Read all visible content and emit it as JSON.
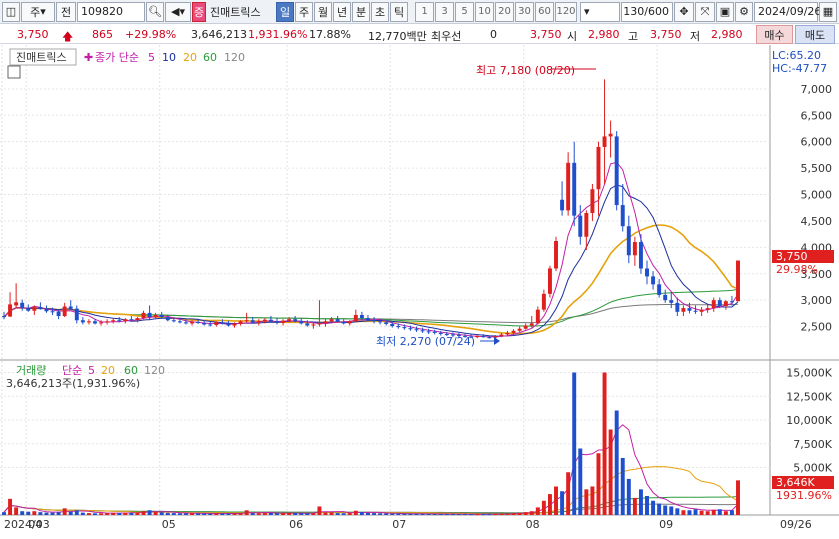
{
  "toolbar": {
    "type_label": "주",
    "prev_label": "전",
    "code": "109820",
    "stock_tag": "증",
    "stock_name": "진매트릭스",
    "periods": [
      "일",
      "주",
      "월",
      "년",
      "분",
      "초",
      "틱"
    ],
    "selected_period": "일",
    "intervals": [
      "1",
      "3",
      "5",
      "10",
      "20",
      "30",
      "60",
      "120"
    ],
    "count": "130/600",
    "date": "2024/09/26"
  },
  "quote": {
    "price": "3,750",
    "change": "865",
    "change_pct": "+29.98%",
    "volume": "3,646,213",
    "volume_pct": "1,931.96%",
    "turnover": "17.88%",
    "amount": "12,770백만",
    "priority_label": "최우선",
    "priority_value": "0",
    "ask": "3,750",
    "open_label": "시",
    "open": "2,980",
    "high_label": "고",
    "high": "3,750",
    "low_label": "저",
    "low": "2,980",
    "buy": "매수",
    "sell": "매도"
  },
  "price_legend": {
    "name": "진매트릭스",
    "ma_label": "종가 단순",
    "ma_periods": [
      "5",
      "10",
      "20",
      "60",
      "120"
    ]
  },
  "volume_legend": {
    "name": "거래량",
    "ma_label": "단순",
    "ma_periods": [
      "5",
      "20",
      "60",
      "120"
    ],
    "summary": "3,646,213주(1,931.96%)"
  },
  "annotations": {
    "high": "최고 7,180 (08/20)",
    "low": "최저 2,270 (07/24)",
    "lc": "LC:65.20",
    "hc": "HC:-47.77"
  },
  "price_axis": {
    "ticks": [
      "7,000",
      "6,500",
      "6,000",
      "5,500",
      "5,000",
      "4,500",
      "4,000",
      "3,500",
      "3,000",
      "2,500"
    ],
    "current": "3,750",
    "current_pct": "29.98%"
  },
  "volume_axis": {
    "ticks": [
      "15,000K",
      "12,500K",
      "10,000K",
      "7,500K",
      "5,000K"
    ],
    "current": "3,646K",
    "current_pct": "1931.96%"
  },
  "x_axis": {
    "labels": [
      "2024/03",
      "04",
      "05",
      "06",
      "07",
      "08",
      "09",
      "09/26"
    ]
  },
  "colors": {
    "up": "#e0201e",
    "down": "#1f4fcc",
    "ma5": "#c21fa8",
    "ma10": "#1c2f9e",
    "ma20": "#e6a20c",
    "ma60": "#2a9a3a",
    "ma120": "#7a7a7a"
  },
  "chart_data": {
    "type": "candlestick",
    "x": [
      "03/26",
      "03/27",
      "03/28",
      "03/29",
      "04/01",
      "04/02",
      "04/03",
      "04/04",
      "04/05",
      "04/08",
      "04/09",
      "04/11",
      "04/12",
      "04/15",
      "04/16",
      "04/17",
      "04/18",
      "04/19",
      "04/22",
      "04/23",
      "04/24",
      "04/25",
      "04/26",
      "04/29",
      "04/30",
      "05/02",
      "05/03",
      "05/07",
      "05/08",
      "05/09",
      "05/10",
      "05/13",
      "05/14",
      "05/16",
      "05/17",
      "05/20",
      "05/21",
      "05/22",
      "05/23",
      "05/24",
      "05/27",
      "05/28",
      "05/29",
      "05/30",
      "05/31",
      "06/03",
      "06/04",
      "06/05",
      "06/07",
      "06/10",
      "06/11",
      "06/12",
      "06/13",
      "06/14",
      "06/17",
      "06/18",
      "06/19",
      "06/20",
      "06/21",
      "06/24",
      "06/25",
      "06/26",
      "06/27",
      "06/28",
      "07/01",
      "07/02",
      "07/03",
      "07/04",
      "07/05",
      "07/08",
      "07/09",
      "07/10",
      "07/11",
      "07/12",
      "07/15",
      "07/16",
      "07/17",
      "07/18",
      "07/19",
      "07/22",
      "07/23",
      "07/24",
      "07/25",
      "07/26",
      "07/29",
      "07/30",
      "07/31",
      "08/01",
      "08/02",
      "08/05",
      "08/06",
      "08/07",
      "08/08",
      "08/09",
      "08/12",
      "08/13",
      "08/14",
      "08/16",
      "08/19",
      "08/20",
      "08/21",
      "08/22",
      "08/23",
      "08/26",
      "08/27",
      "08/28",
      "08/29",
      "08/30",
      "09/02",
      "09/03",
      "09/04",
      "09/05",
      "09/06",
      "09/09",
      "09/10",
      "09/11",
      "09/12",
      "09/13",
      "09/19",
      "09/20",
      "09/23",
      "09/24",
      "09/25",
      "09/26"
    ],
    "ohlc": [
      [
        2700,
        2780,
        2640,
        2680
      ],
      [
        2690,
        3150,
        2680,
        2920
      ],
      [
        2900,
        3320,
        2850,
        2960
      ],
      [
        2950,
        3010,
        2800,
        2860
      ],
      [
        2860,
        2920,
        2780,
        2800
      ],
      [
        2800,
        2900,
        2720,
        2870
      ],
      [
        2870,
        2960,
        2820,
        2830
      ],
      [
        2830,
        2900,
        2760,
        2790
      ],
      [
        2790,
        2860,
        2720,
        2780
      ],
      [
        2780,
        2820,
        2640,
        2700
      ],
      [
        2700,
        2950,
        2680,
        2880
      ],
      [
        2880,
        3000,
        2820,
        2840
      ],
      [
        2840,
        2900,
        2560,
        2620
      ],
      [
        2620,
        2680,
        2540,
        2580
      ],
      [
        2580,
        2640,
        2540,
        2600
      ],
      [
        2600,
        2640,
        2540,
        2560
      ],
      [
        2560,
        2620,
        2520,
        2580
      ],
      [
        2580,
        2640,
        2540,
        2600
      ],
      [
        2600,
        2660,
        2560,
        2620
      ],
      [
        2620,
        2680,
        2580,
        2600
      ],
      [
        2600,
        2660,
        2560,
        2640
      ],
      [
        2640,
        2700,
        2600,
        2620
      ],
      [
        2620,
        2680,
        2580,
        2660
      ],
      [
        2660,
        2800,
        2640,
        2760
      ],
      [
        2760,
        2900,
        2620,
        2680
      ],
      [
        2680,
        2760,
        2640,
        2720
      ],
      [
        2720,
        2780,
        2660,
        2680
      ],
      [
        2680,
        2720,
        2600,
        2620
      ],
      [
        2620,
        2680,
        2580,
        2600
      ],
      [
        2600,
        2660,
        2560,
        2580
      ],
      [
        2580,
        2640,
        2540,
        2560
      ],
      [
        2560,
        2620,
        2520,
        2590
      ],
      [
        2590,
        2650,
        2550,
        2570
      ],
      [
        2570,
        2620,
        2520,
        2540
      ],
      [
        2540,
        2600,
        2500,
        2530
      ],
      [
        2530,
        2600,
        2500,
        2580
      ],
      [
        2580,
        2640,
        2540,
        2560
      ],
      [
        2560,
        2610,
        2500,
        2520
      ],
      [
        2520,
        2580,
        2480,
        2550
      ],
      [
        2550,
        2620,
        2520,
        2600
      ],
      [
        2600,
        2760,
        2580,
        2620
      ],
      [
        2620,
        2680,
        2560,
        2580
      ],
      [
        2580,
        2640,
        2520,
        2600
      ],
      [
        2600,
        2660,
        2560,
        2630
      ],
      [
        2630,
        2700,
        2580,
        2600
      ],
      [
        2600,
        2660,
        2540,
        2570
      ],
      [
        2570,
        2640,
        2520,
        2610
      ],
      [
        2610,
        2680,
        2580,
        2640
      ],
      [
        2640,
        2700,
        2580,
        2600
      ],
      [
        2600,
        2660,
        2540,
        2560
      ],
      [
        2560,
        2620,
        2500,
        2520
      ],
      [
        2520,
        2580,
        2460,
        2540
      ],
      [
        2540,
        3000,
        2500,
        2560
      ],
      [
        2560,
        2640,
        2500,
        2600
      ],
      [
        2600,
        2680,
        2560,
        2640
      ],
      [
        2640,
        2700,
        2580,
        2590
      ],
      [
        2590,
        2640,
        2540,
        2560
      ],
      [
        2560,
        2620,
        2520,
        2600
      ],
      [
        2600,
        2820,
        2580,
        2720
      ],
      [
        2720,
        2780,
        2620,
        2660
      ],
      [
        2660,
        2720,
        2600,
        2620
      ],
      [
        2620,
        2680,
        2560,
        2600
      ],
      [
        2600,
        2640,
        2540,
        2580
      ],
      [
        2580,
        2620,
        2520,
        2550
      ],
      [
        2550,
        2600,
        2480,
        2510
      ],
      [
        2510,
        2560,
        2460,
        2490
      ],
      [
        2490,
        2540,
        2440,
        2470
      ],
      [
        2470,
        2520,
        2420,
        2450
      ],
      [
        2450,
        2500,
        2400,
        2430
      ],
      [
        2430,
        2480,
        2380,
        2410
      ],
      [
        2410,
        2460,
        2360,
        2400
      ],
      [
        2400,
        2440,
        2350,
        2380
      ],
      [
        2380,
        2420,
        2330,
        2360
      ],
      [
        2360,
        2400,
        2320,
        2350
      ],
      [
        2350,
        2390,
        2300,
        2340
      ],
      [
        2340,
        2380,
        2300,
        2320
      ],
      [
        2320,
        2360,
        2290,
        2310
      ],
      [
        2310,
        2350,
        2280,
        2300
      ],
      [
        2300,
        2340,
        2280,
        2320
      ],
      [
        2320,
        2360,
        2290,
        2300
      ],
      [
        2300,
        2330,
        2270,
        2290
      ],
      [
        2290,
        2340,
        2270,
        2320
      ],
      [
        2320,
        2380,
        2300,
        2350
      ],
      [
        2350,
        2420,
        2330,
        2380
      ],
      [
        2380,
        2450,
        2350,
        2420
      ],
      [
        2420,
        2500,
        2400,
        2460
      ],
      [
        2460,
        2560,
        2440,
        2520
      ],
      [
        2520,
        2700,
        2480,
        2560
      ],
      [
        2560,
        2880,
        2540,
        2820
      ],
      [
        2820,
        3200,
        2780,
        3120
      ],
      [
        3120,
        3650,
        3050,
        3600
      ],
      [
        3600,
        4200,
        3550,
        4120
      ],
      [
        4900,
        5250,
        4600,
        4700
      ],
      [
        4700,
        5800,
        4600,
        5600
      ],
      [
        5600,
        6000,
        4400,
        4600
      ],
      [
        4600,
        4800,
        4050,
        4200
      ],
      [
        4200,
        4700,
        3950,
        4650
      ],
      [
        4650,
        5200,
        4500,
        5100
      ],
      [
        5100,
        6000,
        4600,
        5900
      ],
      [
        5900,
        7180,
        5200,
        6100
      ],
      [
        6100,
        6400,
        5700,
        6150
      ],
      [
        6100,
        6200,
        4700,
        4800
      ],
      [
        4800,
        5200,
        4300,
        4400
      ],
      [
        4400,
        4600,
        3700,
        3850
      ],
      [
        3850,
        4200,
        3650,
        4100
      ],
      [
        4100,
        4250,
        3500,
        3600
      ],
      [
        3600,
        3750,
        3300,
        3450
      ],
      [
        3450,
        3550,
        3200,
        3300
      ],
      [
        3300,
        3400,
        3050,
        3100
      ],
      [
        3100,
        3200,
        2950,
        3000
      ],
      [
        3000,
        3150,
        2850,
        2950
      ],
      [
        2950,
        3050,
        2700,
        2780
      ],
      [
        2780,
        2900,
        2700,
        2850
      ],
      [
        2850,
        2950,
        2750,
        2800
      ],
      [
        2800,
        2900,
        2740,
        2780
      ],
      [
        2780,
        2870,
        2700,
        2820
      ],
      [
        2820,
        2920,
        2760,
        2850
      ],
      [
        2850,
        3050,
        2780,
        3000
      ],
      [
        3000,
        3050,
        2850,
        2890
      ],
      [
        2890,
        3000,
        2820,
        2980
      ],
      [
        2980,
        3080,
        2900,
        2960
      ],
      [
        2980,
        3750,
        2980,
        3750
      ]
    ],
    "volume_k": [
      300,
      1700,
      800,
      400,
      350,
      400,
      300,
      250,
      250,
      300,
      700,
      350,
      500,
      250,
      200,
      180,
      180,
      200,
      220,
      200,
      250,
      220,
      260,
      400,
      500,
      300,
      280,
      220,
      200,
      180,
      170,
      170,
      160,
      150,
      140,
      170,
      160,
      150,
      150,
      170,
      500,
      200,
      180,
      200,
      220,
      180,
      200,
      220,
      200,
      180,
      170,
      160,
      900,
      250,
      260,
      200,
      180,
      200,
      450,
      300,
      220,
      200,
      180,
      160,
      150,
      140,
      130,
      120,
      120,
      110,
      110,
      100,
      100,
      100,
      100,
      100,
      100,
      90,
      90,
      90,
      90,
      100,
      120,
      150,
      180,
      220,
      300,
      400,
      800,
      1500,
      2200,
      3000,
      2500,
      4500,
      15000,
      7000,
      2700,
      3000,
      6500,
      15000,
      9000,
      11000,
      6000,
      3800,
      1800,
      2700,
      2000,
      1500,
      1200,
      1000,
      900,
      700,
      500,
      500,
      600,
      450,
      400,
      550,
      600,
      400,
      500,
      3646
    ],
    "ylim": [
      2000,
      7300
    ],
    "volume_ylim": [
      0,
      16000
    ]
  }
}
